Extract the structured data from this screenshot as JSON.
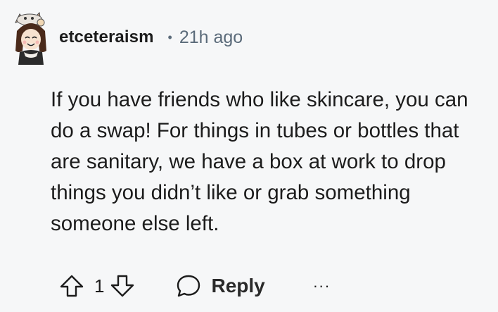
{
  "comment": {
    "username": "etceteraism",
    "separator": "•",
    "time": "21h ago",
    "body": "If you have friends who like skincare, you can do a swap! For things in tubes or bottles that are sanitary, we have a box at work to drop things you didn’t like or grab something someone else left.",
    "score": "1",
    "reply_label": "Reply",
    "more_label": "···"
  },
  "icons": {
    "avatar": "avatar-icon",
    "upvote": "upvote-arrow-icon",
    "downvote": "downvote-arrow-icon",
    "reply": "speech-bubble-icon",
    "more": "ellipsis-icon"
  }
}
